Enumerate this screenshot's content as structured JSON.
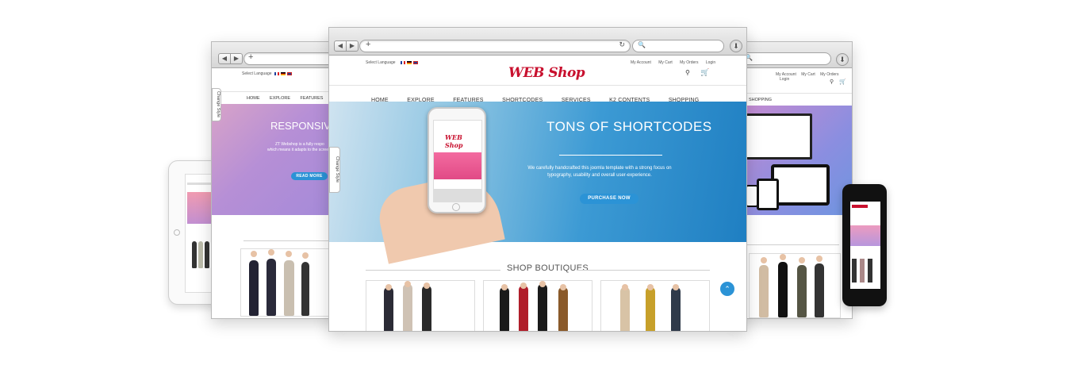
{
  "lang": {
    "label": "Select Language"
  },
  "account_links": [
    "My Account",
    "My Cart",
    "My Orders",
    "Login"
  ],
  "logo": {
    "text": "WEB Shop"
  },
  "menu": [
    "HOME",
    "EXPLORE",
    "FEATURES",
    "SHORTCODES",
    "SERVICES",
    "K2 CONTENTS",
    "SHOPPING"
  ],
  "hero": {
    "title": "TONS OF SHORTCODES",
    "text": "We carefully handcrafted this joomla template with a strong focus on typography, usability and overall user-experience.",
    "button": "PURCHASE NOW"
  },
  "section_title": "SHOP BOUTIQUES",
  "change_style": "Change Style",
  "left_browser": {
    "menu": [
      "HOME",
      "EXPLORE",
      "FEATURES"
    ],
    "hero_title": "RESPONSIVE D",
    "hero_text": [
      "ZT Webshop is a fully respo",
      "which means it adapts to the screen"
    ],
    "button": "READ MORE"
  },
  "right_browser": {
    "menu": [
      "SHOPPING"
    ]
  },
  "colors": {
    "accent": "#2b93d6",
    "logo_red": "#c8102e"
  }
}
